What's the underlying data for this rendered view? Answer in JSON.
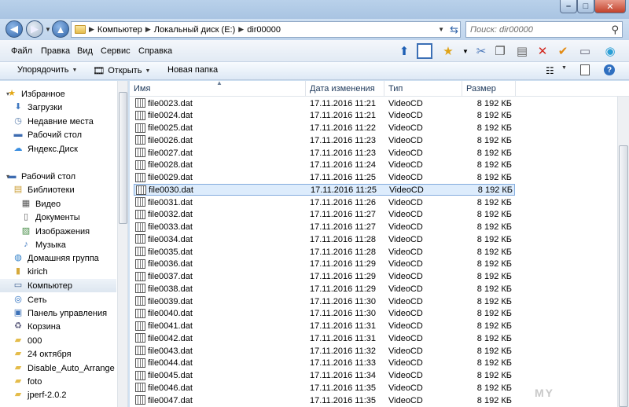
{
  "window": {
    "min": "–",
    "max": "□",
    "close": "✕"
  },
  "address": {
    "crumbs": [
      "Компьютер",
      "Локальный диск (E:)",
      "dir00000"
    ],
    "search_placeholder": "Поиск: dir00000"
  },
  "menu": [
    "Файл",
    "Правка",
    "Вид",
    "Сервис",
    "Справка"
  ],
  "commands": {
    "organize": "Упорядочить",
    "open": "Открыть",
    "new_folder": "Новая папка"
  },
  "navpane": [
    {
      "label": "Избранное",
      "icon": "star-icon",
      "group": true
    },
    {
      "label": "Загрузки",
      "icon": "downloads-icon"
    },
    {
      "label": "Недавние места",
      "icon": "recent-places-icon"
    },
    {
      "label": "Рабочий стол",
      "icon": "desktop-icon"
    },
    {
      "label": "Яндекс.Диск",
      "icon": "yandex-disk-icon"
    },
    {
      "label": "Рабочий стол",
      "icon": "desktop-icon",
      "group": true
    },
    {
      "label": "Библиотеки",
      "icon": "libraries-icon"
    },
    {
      "label": "Видео",
      "icon": "video-icon"
    },
    {
      "label": "Документы",
      "icon": "documents-icon"
    },
    {
      "label": "Изображения",
      "icon": "pictures-icon"
    },
    {
      "label": "Музыка",
      "icon": "music-icon"
    },
    {
      "label": "Домашняя группа",
      "icon": "homegroup-icon"
    },
    {
      "label": "kirich",
      "icon": "user-folder-icon"
    },
    {
      "label": "Компьютер",
      "icon": "computer-icon",
      "selected": true
    },
    {
      "label": "Сеть",
      "icon": "network-icon"
    },
    {
      "label": "Панель управления",
      "icon": "control-panel-icon"
    },
    {
      "label": "Корзина",
      "icon": "recycle-bin-icon"
    },
    {
      "label": "000",
      "icon": "folder-icon"
    },
    {
      "label": "24 октября",
      "icon": "folder-icon"
    },
    {
      "label": "Disable_Auto_Arrange",
      "icon": "folder-icon"
    },
    {
      "label": "foto",
      "icon": "folder-icon"
    },
    {
      "label": "jperf-2.0.2",
      "icon": "folder-icon"
    }
  ],
  "columns": {
    "name": "Имя",
    "date": "Дата изменения",
    "type": "Тип",
    "size": "Размер"
  },
  "files": [
    {
      "name": "file0023.dat",
      "date": "17.11.2016 11:21",
      "type": "VideoCD",
      "size": "8 192 КБ"
    },
    {
      "name": "file0024.dat",
      "date": "17.11.2016 11:21",
      "type": "VideoCD",
      "size": "8 192 КБ"
    },
    {
      "name": "file0025.dat",
      "date": "17.11.2016 11:22",
      "type": "VideoCD",
      "size": "8 192 КБ"
    },
    {
      "name": "file0026.dat",
      "date": "17.11.2016 11:23",
      "type": "VideoCD",
      "size": "8 192 КБ"
    },
    {
      "name": "file0027.dat",
      "date": "17.11.2016 11:23",
      "type": "VideoCD",
      "size": "8 192 КБ"
    },
    {
      "name": "file0028.dat",
      "date": "17.11.2016 11:24",
      "type": "VideoCD",
      "size": "8 192 КБ"
    },
    {
      "name": "file0029.dat",
      "date": "17.11.2016 11:25",
      "type": "VideoCD",
      "size": "8 192 КБ"
    },
    {
      "name": "file0030.dat",
      "date": "17.11.2016 11:25",
      "type": "VideoCD",
      "size": "8 192 КБ",
      "selected": true
    },
    {
      "name": "file0031.dat",
      "date": "17.11.2016 11:26",
      "type": "VideoCD",
      "size": "8 192 КБ"
    },
    {
      "name": "file0032.dat",
      "date": "17.11.2016 11:27",
      "type": "VideoCD",
      "size": "8 192 КБ"
    },
    {
      "name": "file0033.dat",
      "date": "17.11.2016 11:27",
      "type": "VideoCD",
      "size": "8 192 КБ"
    },
    {
      "name": "file0034.dat",
      "date": "17.11.2016 11:28",
      "type": "VideoCD",
      "size": "8 192 КБ"
    },
    {
      "name": "file0035.dat",
      "date": "17.11.2016 11:28",
      "type": "VideoCD",
      "size": "8 192 КБ"
    },
    {
      "name": "file0036.dat",
      "date": "17.11.2016 11:29",
      "type": "VideoCD",
      "size": "8 192 КБ"
    },
    {
      "name": "file0037.dat",
      "date": "17.11.2016 11:29",
      "type": "VideoCD",
      "size": "8 192 КБ"
    },
    {
      "name": "file0038.dat",
      "date": "17.11.2016 11:29",
      "type": "VideoCD",
      "size": "8 192 КБ"
    },
    {
      "name": "file0039.dat",
      "date": "17.11.2016 11:30",
      "type": "VideoCD",
      "size": "8 192 КБ"
    },
    {
      "name": "file0040.dat",
      "date": "17.11.2016 11:30",
      "type": "VideoCD",
      "size": "8 192 КБ"
    },
    {
      "name": "file0041.dat",
      "date": "17.11.2016 11:31",
      "type": "VideoCD",
      "size": "8 192 КБ"
    },
    {
      "name": "file0042.dat",
      "date": "17.11.2016 11:31",
      "type": "VideoCD",
      "size": "8 192 КБ"
    },
    {
      "name": "file0043.dat",
      "date": "17.11.2016 11:32",
      "type": "VideoCD",
      "size": "8 192 КБ"
    },
    {
      "name": "file0044.dat",
      "date": "17.11.2016 11:33",
      "type": "VideoCD",
      "size": "8 192 КБ"
    },
    {
      "name": "file0045.dat",
      "date": "17.11.2016 11:34",
      "type": "VideoCD",
      "size": "8 192 КБ"
    },
    {
      "name": "file0046.dat",
      "date": "17.11.2016 11:35",
      "type": "VideoCD",
      "size": "8 192 КБ"
    },
    {
      "name": "file0047.dat",
      "date": "17.11.2016 11:35",
      "type": "VideoCD",
      "size": "8 192 КБ"
    }
  ],
  "watermark": "MY"
}
